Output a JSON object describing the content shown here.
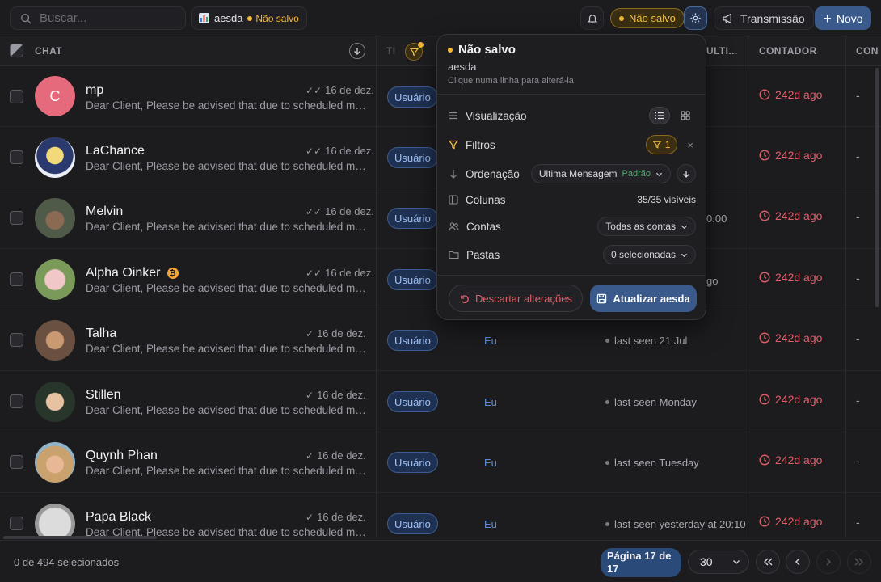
{
  "search": {
    "placeholder": "Buscar..."
  },
  "view_chip": {
    "name": "aesda",
    "status": "Não salvo"
  },
  "unsaved_pill": "Não salvo",
  "broadcast_label": "Transmissão",
  "new_label": "Novo",
  "columns": {
    "chat": "CHAT",
    "type_partial": "TI",
    "last_partial": "ULTI...",
    "counter": "CONTADOR",
    "con_partial": "CON"
  },
  "rows": [
    {
      "name": "mp",
      "avatar_letter": "C",
      "date": "16 de dez.",
      "preview": "Dear Client, Please be advised that due to scheduled ma...",
      "type": "Usuário",
      "assignee": "",
      "last_seen": "",
      "counter": "242d ago",
      "extra": "-"
    },
    {
      "name": "LaChance",
      "avatar_letter": "",
      "date": "16 de dez.",
      "preview": "Dear Client, Please be advised that due to scheduled ma...",
      "type": "Usuário",
      "assignee": "",
      "last_seen": "",
      "counter": "242d ago",
      "extra": "-"
    },
    {
      "name": "Melvin",
      "avatar_letter": "",
      "date": "16 de dez.",
      "preview": "Dear Client, Please be advised that due to scheduled ma...",
      "type": "Usuário",
      "assignee": "",
      "last_seen": "0:00",
      "counter": "242d ago",
      "extra": "-"
    },
    {
      "name": "Alpha Oinker",
      "avatar_letter": "",
      "date": "16 de dez.",
      "preview": "Dear Client, Please be advised that due to scheduled ma...",
      "type": "Usuário",
      "assignee": "",
      "last_seen": "go",
      "counter": "242d ago",
      "extra": "-"
    },
    {
      "name": "Talha",
      "avatar_letter": "",
      "date": "16 de dez.",
      "preview": "Dear Client, Please be advised that due to scheduled ma...",
      "type": "Usuário",
      "assignee": "Eu",
      "last_seen": "last seen 21 Jul",
      "counter": "242d ago",
      "extra": "-"
    },
    {
      "name": "Stillen",
      "avatar_letter": "",
      "date": "16 de dez.",
      "preview": "Dear Client, Please be advised that due to scheduled ma...",
      "type": "Usuário",
      "assignee": "Eu",
      "last_seen": "last seen Monday",
      "counter": "242d ago",
      "extra": "-"
    },
    {
      "name": "Quynh Phan",
      "avatar_letter": "",
      "date": "16 de dez.",
      "preview": "Dear Client, Please be advised that due to scheduled ma...",
      "type": "Usuário",
      "assignee": "Eu",
      "last_seen": "last seen Tuesday",
      "counter": "242d ago",
      "extra": "-"
    },
    {
      "name": "Papa Black",
      "avatar_letter": "",
      "date": "16 de dez.",
      "preview": "Dear Client, Please be advised that due to scheduled ma...",
      "type": "Usuário",
      "assignee": "Eu",
      "last_seen": "last seen yesterday at 20:10",
      "counter": "242d ago",
      "extra": "-"
    }
  ],
  "popover": {
    "title": "Não salvo",
    "view_name": "aesda",
    "hint": "Clique numa linha para alterá-la",
    "visualizacao": "Visualização",
    "filtros": "Filtros",
    "filter_count": "1",
    "ordenacao": "Ordenação",
    "sort_value": "Ultima Mensagem",
    "sort_default": "Padrão",
    "colunas": "Colunas",
    "colunas_value": "35/35 visíveis",
    "contas": "Contas",
    "contas_value": "Todas as contas",
    "pastas": "Pastas",
    "pastas_value": "0 selecionadas",
    "discard": "Descartar alterações",
    "update": "Atualizar aesda"
  },
  "footer": {
    "selected": "0 de 494 selecionados",
    "page": "Página 17 de 17",
    "page_size": "30"
  },
  "colors": {
    "accent": "#3a5a8c",
    "unsaved": "#f5c242",
    "counter_red": "#e05e6a",
    "user_badge": "#9ec0f5"
  }
}
